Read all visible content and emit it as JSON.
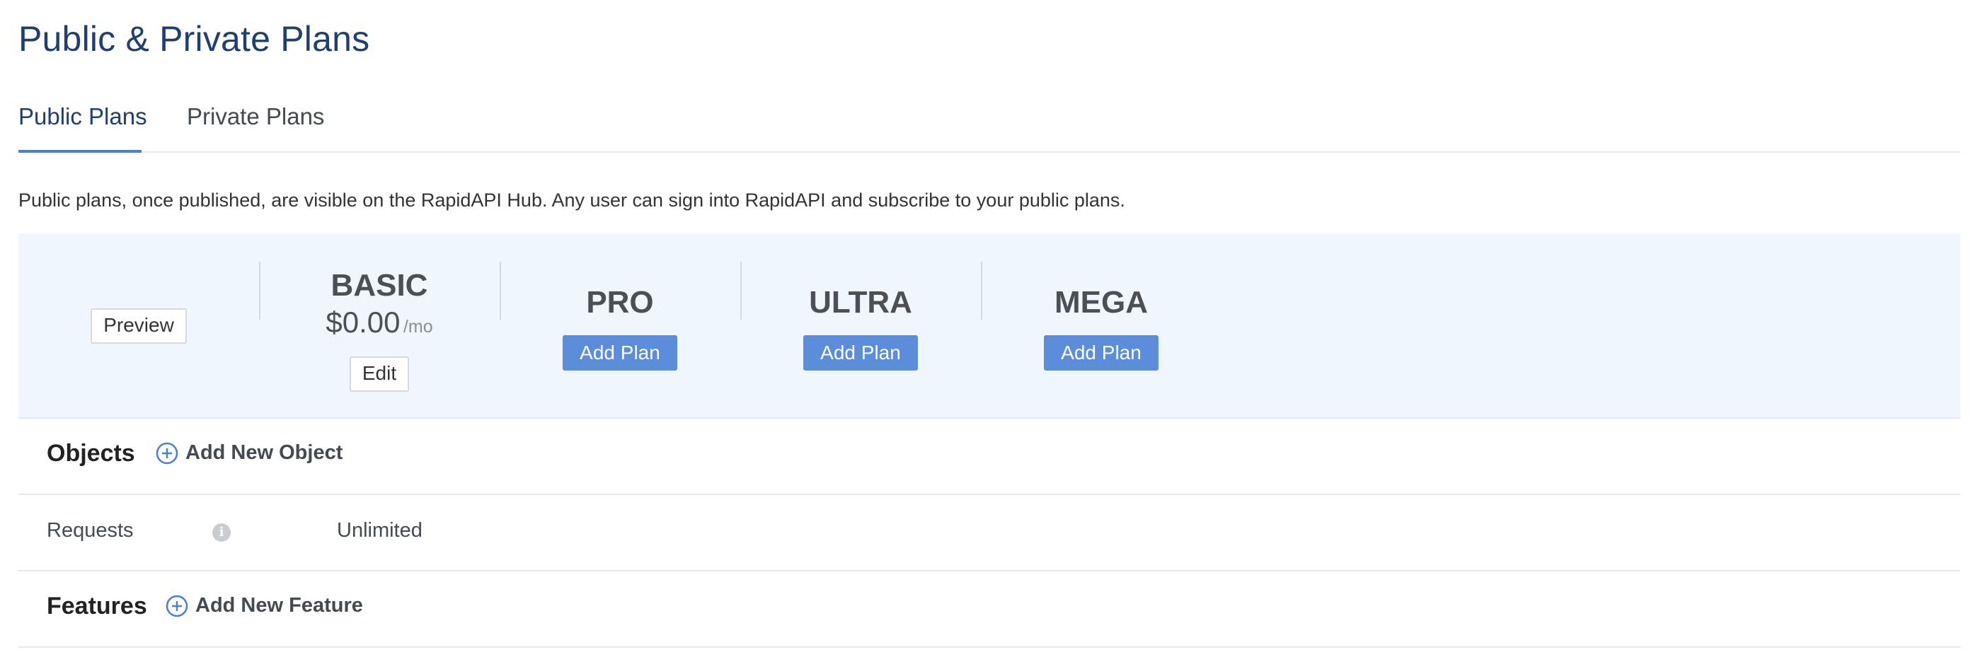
{
  "page": {
    "title": "Public & Private Plans"
  },
  "tabs": [
    {
      "label": "Public Plans",
      "active": true
    },
    {
      "label": "Private Plans",
      "active": false
    }
  ],
  "description": "Public plans, once published, are visible on the RapidAPI Hub. Any user can sign into RapidAPI and subscribe to your public plans.",
  "plans_header": {
    "preview_label": "Preview",
    "plans": [
      {
        "name": "BASIC",
        "price": "$0.00",
        "per": "/mo",
        "action_label": "Edit"
      },
      {
        "name": "PRO",
        "action_label": "Add Plan"
      },
      {
        "name": "ULTRA",
        "action_label": "Add Plan"
      },
      {
        "name": "MEGA",
        "action_label": "Add Plan"
      }
    ]
  },
  "objects_section": {
    "title": "Objects",
    "add_label": "Add New Object",
    "icon": "plus-circle-icon"
  },
  "requests_row": {
    "label": "Requests",
    "info_icon": "info-icon",
    "basic_value": "Unlimited"
  },
  "features_section": {
    "title": "Features",
    "add_label": "Add New Feature",
    "icon": "plus-circle-icon"
  },
  "colors": {
    "title": "#1f3f73",
    "accent": "#4a7fd4",
    "primary_button": "#5b8ddb",
    "header_bg": "#eff6fd"
  }
}
